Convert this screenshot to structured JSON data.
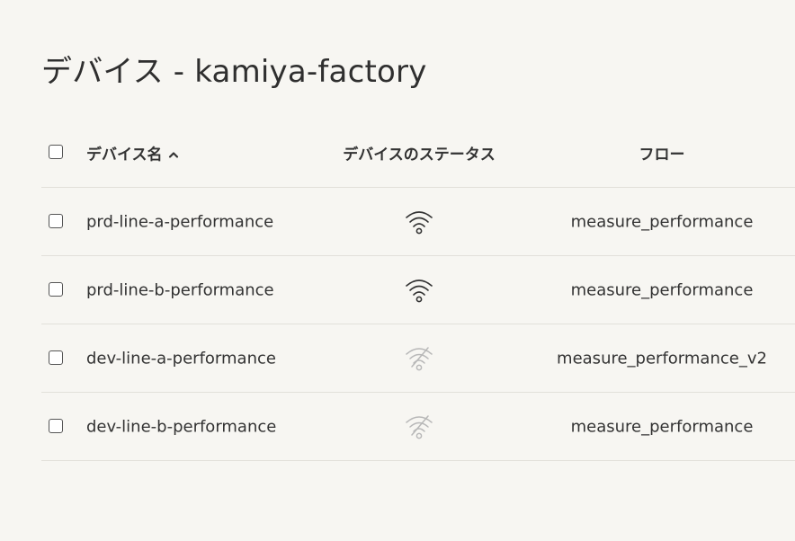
{
  "page": {
    "title": "デバイス - kamiya-factory"
  },
  "table": {
    "columns": {
      "name": "デバイス名",
      "status": "デバイスのステータス",
      "flow": "フロー"
    },
    "sort": {
      "column": "name",
      "direction": "ascending",
      "icon": "chevron-up-icon"
    },
    "rows": [
      {
        "name": "prd-line-a-performance",
        "status": "online",
        "status_icon": "wifi-icon",
        "flow": "measure_performance"
      },
      {
        "name": "prd-line-b-performance",
        "status": "online",
        "status_icon": "wifi-icon",
        "flow": "measure_performance"
      },
      {
        "name": "dev-line-a-performance",
        "status": "offline",
        "status_icon": "wifi-off-icon",
        "flow": "measure_performance_v2"
      },
      {
        "name": "dev-line-b-performance",
        "status": "offline",
        "status_icon": "wifi-off-icon",
        "flow": "measure_performance"
      }
    ]
  },
  "colors": {
    "background": "#f7f6f2",
    "text": "#333333",
    "divider": "#e2e0da",
    "status_online": "#333333",
    "status_offline": "#b8b8b8"
  }
}
